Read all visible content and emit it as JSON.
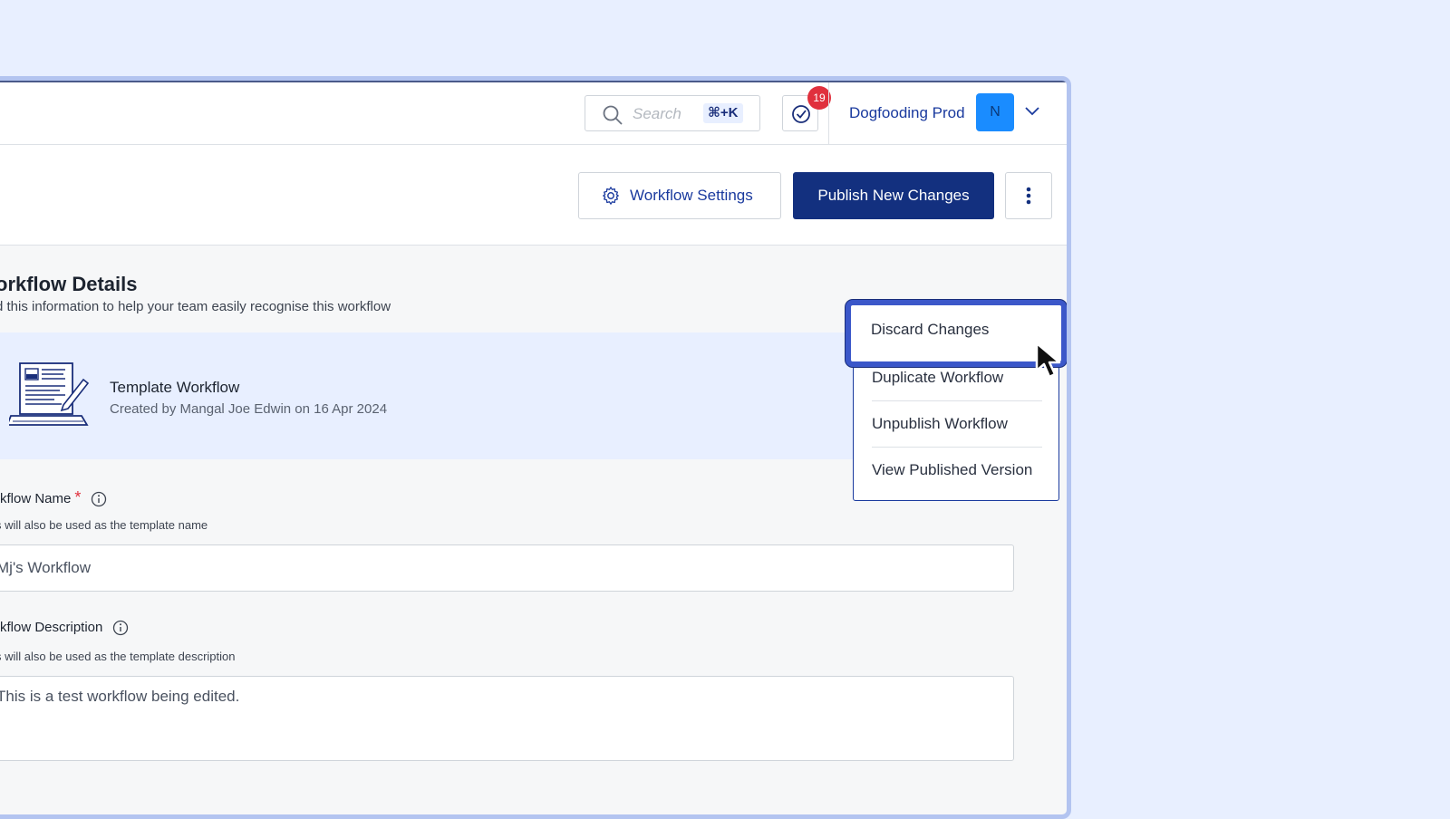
{
  "header": {
    "search_placeholder": "Search",
    "search_shortcut": "⌘+K",
    "tasks_badge": "19",
    "org_name": "Dogfooding Prod",
    "avatar_initial": "N"
  },
  "toolbar": {
    "settings_label": "Workflow Settings",
    "publish_label": "Publish New Changes"
  },
  "menu": {
    "items": [
      "Discard Changes",
      "Duplicate Workflow",
      "Unpublish Workflow",
      "View Published Version"
    ]
  },
  "details": {
    "title": "orkflow Details",
    "subtitle": "d this information to help your team easily recognise this workflow",
    "template_name": "Template Workflow",
    "template_meta": "Created by Mangal Joe Edwin on 16 Apr 2024",
    "name_label": "rkflow Name",
    "name_required": "*",
    "name_help": "s will also be used as the template name",
    "name_value": "Mj's Workflow",
    "desc_label": "rkflow Description",
    "desc_help": "s will also be used as the template description",
    "desc_value": "This is a test workflow being edited."
  },
  "colors": {
    "brand": "#13307f",
    "accent": "#1a3a9e",
    "badge": "#e0303d",
    "background": "#e8efff"
  }
}
